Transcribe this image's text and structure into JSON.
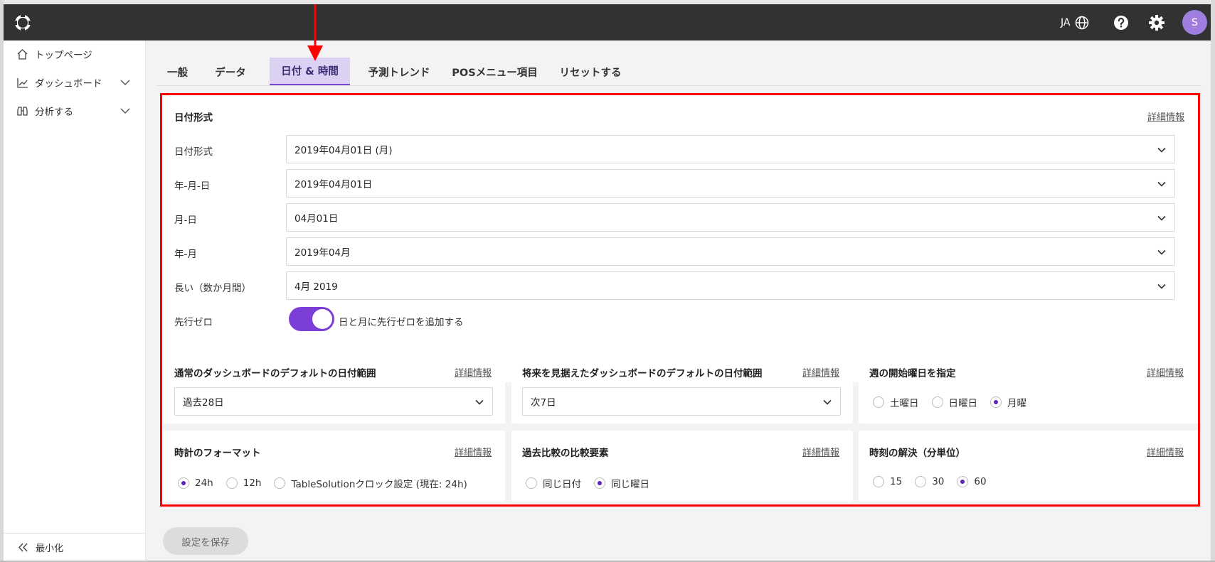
{
  "topbar": {
    "lang": "JA",
    "avatar": "S"
  },
  "sidebar": {
    "items": [
      {
        "label": "トップページ",
        "icon": "home-icon"
      },
      {
        "label": "ダッシュボード",
        "icon": "chart-icon"
      },
      {
        "label": "分析する",
        "icon": "binoculars-icon"
      }
    ],
    "minimize": "最小化"
  },
  "tabs": [
    "一般",
    "データ",
    "日付 & 時間",
    "予測トレンド",
    "POSメニュー項目",
    "リセットする"
  ],
  "date_format": {
    "title": "日付形式",
    "more": "詳細情報",
    "rows": [
      {
        "label": "日付形式",
        "value": "2019年04月01日 (月)"
      },
      {
        "label": "年-月-日",
        "value": "2019年04月01日"
      },
      {
        "label": "月-日",
        "value": "04月01日"
      },
      {
        "label": "年-月",
        "value": "2019年04月"
      },
      {
        "label": "長い（数か月間）",
        "value": "4月 2019"
      }
    ],
    "leading_zero": {
      "label": "先行ゼロ",
      "text": "日と月に先行ゼロを追加する",
      "on": true
    }
  },
  "cards": {
    "regular_range": {
      "title": "通常のダッシュボードのデフォルトの日付範囲",
      "more": "詳細情報",
      "value": "過去28日"
    },
    "future_range": {
      "title": "将来を見据えたダッシュボードのデフォルトの日付範囲",
      "more": "詳細情報",
      "value": "次7日"
    },
    "week_start": {
      "title": "週の開始曜日を指定",
      "more": "詳細情報",
      "options": [
        "土曜日",
        "日曜日",
        "月曜"
      ],
      "selected": 2
    },
    "clock": {
      "title": "時計のフォーマット",
      "more": "詳細情報",
      "options": [
        "24h",
        "12h",
        "TableSolutionクロック設定 (現在: 24h)"
      ],
      "selected": 0
    },
    "compare": {
      "title": "過去比較の比較要素",
      "more": "詳細情報",
      "options": [
        "同じ日付",
        "同じ曜日"
      ],
      "selected": 1
    },
    "resolution": {
      "title": "時刻の解決（分単位）",
      "more": "詳細情報",
      "options": [
        "15",
        "30",
        "60"
      ],
      "selected": 2
    }
  },
  "save_label": "設定を保存",
  "colors": {
    "accent": "#7b3fd8",
    "highlight_box": "#ff0000",
    "topbar": "#323232"
  }
}
